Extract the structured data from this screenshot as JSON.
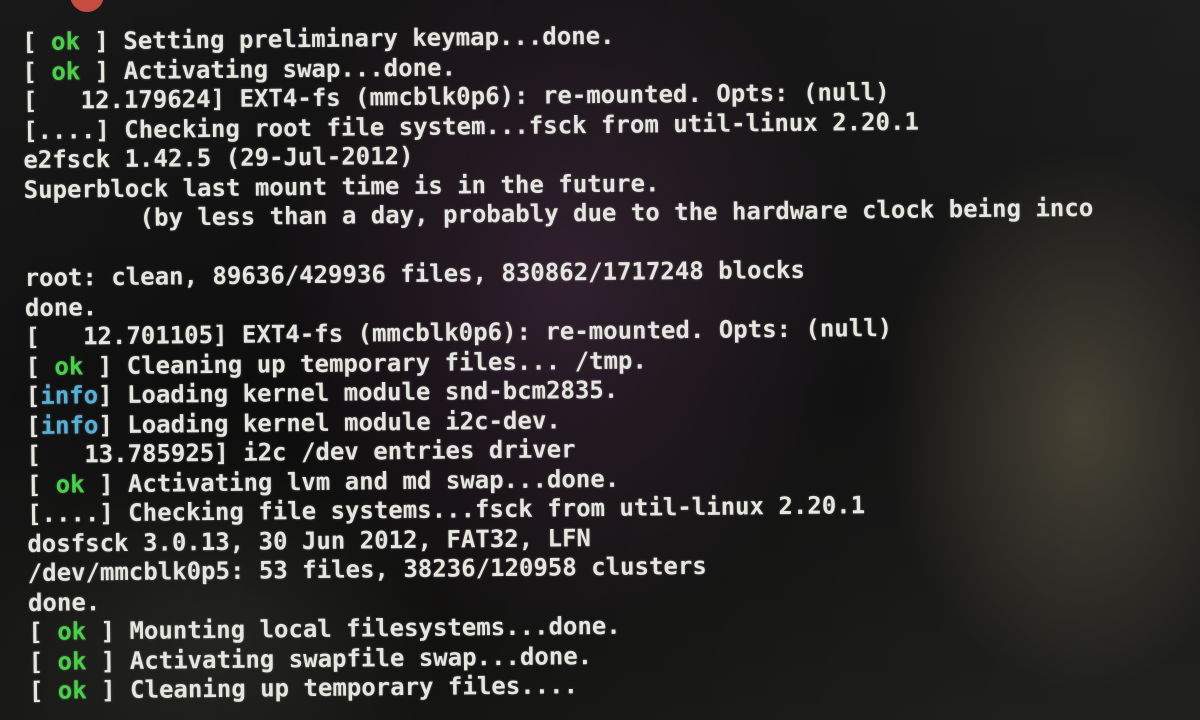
{
  "console": {
    "lines": [
      {
        "pre": "[ ",
        "tag": "ok",
        "post": " ] Setting preliminary keymap...done."
      },
      {
        "pre": "[ ",
        "tag": "ok",
        "post": " ] Activating swap...done."
      },
      {
        "text": "[   12.179624] EXT4-fs (mmcblk0p6): re-mounted. Opts: (null)"
      },
      {
        "text": "[....] Checking root file system...fsck from util-linux 2.20.1"
      },
      {
        "text": "e2fsck 1.42.5 (29-Jul-2012)"
      },
      {
        "text": "Superblock last mount time is in the future."
      },
      {
        "text": "        (by less than a day, probably due to the hardware clock being inco"
      },
      {
        "text": ""
      },
      {
        "text": "root: clean, 89636/429936 files, 830862/1717248 blocks"
      },
      {
        "text": "done."
      },
      {
        "text": "[   12.701105] EXT4-fs (mmcblk0p6): re-mounted. Opts: (null)"
      },
      {
        "pre": "[ ",
        "tag": "ok",
        "post": " ] Cleaning up temporary files... /tmp."
      },
      {
        "pre": "[",
        "tag": "info",
        "post": "] Loading kernel module snd-bcm2835."
      },
      {
        "pre": "[",
        "tag": "info",
        "post": "] Loading kernel module i2c-dev."
      },
      {
        "text": "[   13.785925] i2c /dev entries driver"
      },
      {
        "pre": "[ ",
        "tag": "ok",
        "post": " ] Activating lvm and md swap...done."
      },
      {
        "text": "[....] Checking file systems...fsck from util-linux 2.20.1"
      },
      {
        "text": "dosfsck 3.0.13, 30 Jun 2012, FAT32, LFN"
      },
      {
        "text": "/dev/mmcblk0p5: 53 files, 38236/120958 clusters"
      },
      {
        "text": "done."
      },
      {
        "pre": "[ ",
        "tag": "ok",
        "post": " ] Mounting local filesystems...done."
      },
      {
        "pre": "[ ",
        "tag": "ok",
        "post": " ] Activating swapfile swap...done."
      },
      {
        "pre": "[ ",
        "tag": "ok",
        "post": " ] Cleaning up temporary files...."
      }
    ]
  },
  "colors": {
    "background": "#060606",
    "text": "#e6e6e0",
    "ok": "#3ed43e",
    "info": "#4fb0dc"
  }
}
